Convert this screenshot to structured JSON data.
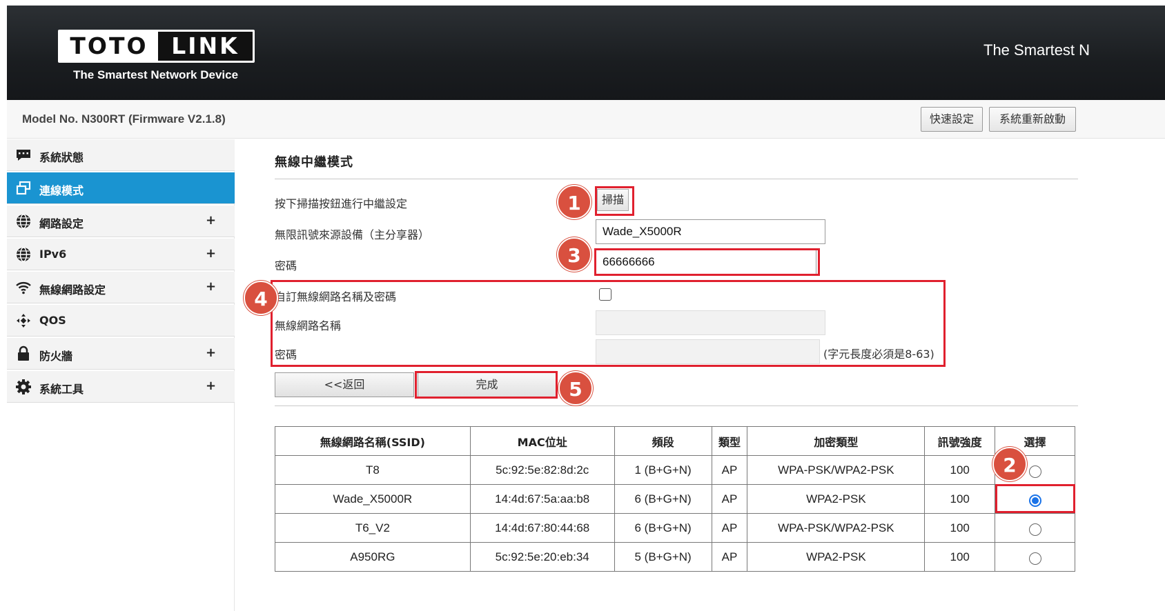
{
  "brand": {
    "logo_left": "TOTO",
    "logo_right": "LINK",
    "tagline_logo": "The Smartest Network Device",
    "tagline_header": "The Smartest N"
  },
  "model_bar": {
    "model_text": "Model No. N300RT (Firmware V2.1.8)",
    "quick_setup": "快速設定",
    "reboot": "系統重新啟動"
  },
  "sidebar": {
    "items": [
      {
        "label": "系統狀態",
        "icon": "chat-bubble-icon",
        "has_plus": false,
        "active": false
      },
      {
        "label": "連線模式",
        "icon": "windows-icon",
        "has_plus": false,
        "active": true
      },
      {
        "label": "網路設定",
        "icon": "globe-icon",
        "has_plus": true,
        "active": false
      },
      {
        "label": "IPv6",
        "icon": "globe-icon",
        "has_plus": true,
        "active": false
      },
      {
        "label": "無線網路設定",
        "icon": "wifi-icon",
        "has_plus": true,
        "active": false
      },
      {
        "label": "QOS",
        "icon": "move-arrows-icon",
        "has_plus": false,
        "active": false
      },
      {
        "label": "防火牆",
        "icon": "lock-icon",
        "has_plus": true,
        "active": false
      },
      {
        "label": "系統工具",
        "icon": "gear-icon",
        "has_plus": true,
        "active": false
      }
    ],
    "plus_symbol": "+"
  },
  "main": {
    "title": "無線中繼模式",
    "scan_prompt": "按下掃描按鈕進行中繼設定",
    "scan_button": "掃描",
    "source_label": "無限訊號來源設備（主分享器）",
    "source_value": "Wade_X5000R",
    "password_label": "密碼",
    "password_value": "66666666",
    "custom_label": "自訂無線網路名稱及密碼",
    "ssid_label": "無線網路名稱",
    "ssid_value": "",
    "custom_password_label": "密碼",
    "custom_password_value": "",
    "password_hint": "(字元長度必須是8-63)",
    "back_button": "<<返回",
    "done_button": "完成"
  },
  "table": {
    "headers": [
      "無線網路名稱(SSID)",
      "MAC位址",
      "頻段",
      "類型",
      "加密類型",
      "訊號強度",
      "選擇"
    ],
    "rows": [
      {
        "ssid": "T8",
        "mac": "5c:92:5e:82:8d:2c",
        "band": "1 (B+G+N)",
        "type": "AP",
        "enc": "WPA-PSK/WPA2-PSK",
        "signal": "100",
        "selected": false
      },
      {
        "ssid": "Wade_X5000R",
        "mac": "14:4d:67:5a:aa:b8",
        "band": "6 (B+G+N)",
        "type": "AP",
        "enc": "WPA2-PSK",
        "signal": "100",
        "selected": true
      },
      {
        "ssid": "T6_V2",
        "mac": "14:4d:67:80:44:68",
        "band": "6 (B+G+N)",
        "type": "AP",
        "enc": "WPA-PSK/WPA2-PSK",
        "signal": "100",
        "selected": false
      },
      {
        "ssid": "A950RG",
        "mac": "5c:92:5e:20:eb:34",
        "band": "5 (B+G+N)",
        "type": "AP",
        "enc": "WPA2-PSK",
        "signal": "100",
        "selected": false
      }
    ]
  },
  "annotations": {
    "step1": "1",
    "step2": "2",
    "step3": "3",
    "step4": "4",
    "step5": "5",
    "highlight_color": "#e0202e",
    "badge_color": "#d9503f"
  },
  "colors": {
    "active_nav": "#1a94d1",
    "header_bg": "#1a1d20"
  }
}
